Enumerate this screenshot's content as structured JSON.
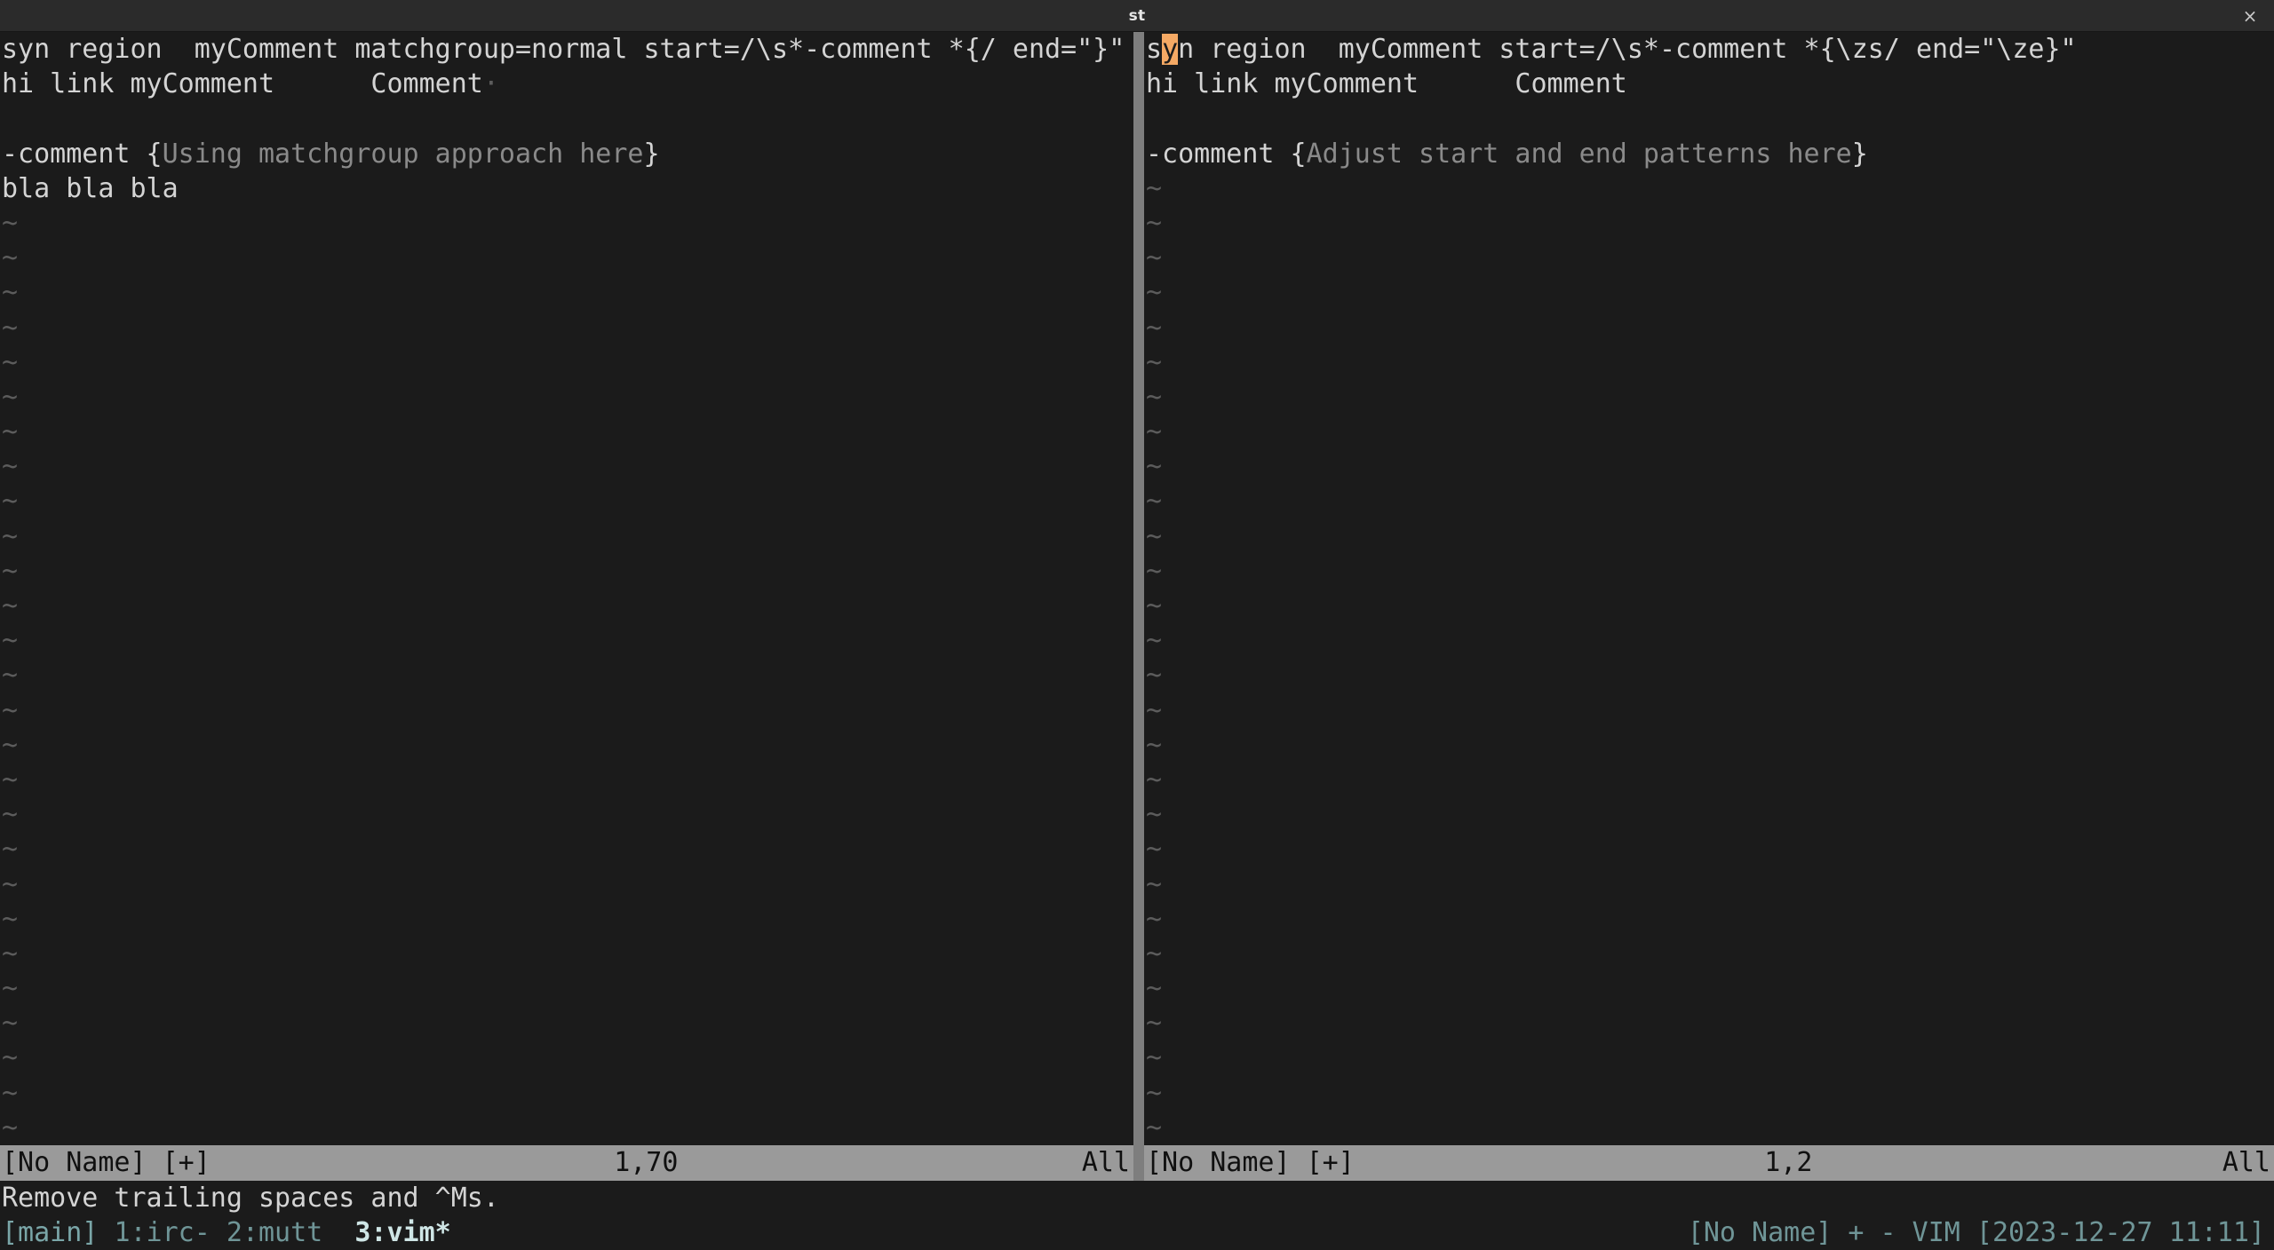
{
  "window": {
    "title": "st",
    "close_icon": "×"
  },
  "panes": [
    {
      "id": "left",
      "lines": [
        {
          "type": "code",
          "segments": [
            {
              "text": "syn region  myComment matchgroup=normal start=/\\s*-comment *{/ end=\"}\"",
              "style": "normal"
            }
          ]
        },
        {
          "type": "code",
          "segments": [
            {
              "text": "hi link myComment      Comment",
              "style": "normal"
            },
            {
              "text": "·",
              "style": "trailing-dot"
            }
          ]
        },
        {
          "type": "code",
          "segments": [
            {
              "text": "",
              "style": "normal"
            }
          ]
        },
        {
          "type": "code",
          "segments": [
            {
              "text": "-comment {",
              "style": "normal"
            },
            {
              "text": "Using matchgroup approach here",
              "style": "dim"
            },
            {
              "text": "}",
              "style": "normal"
            }
          ]
        },
        {
          "type": "code",
          "segments": [
            {
              "text": "bla bla bla",
              "style": "normal"
            }
          ]
        }
      ],
      "filler_char": "~",
      "filler_count": 27,
      "status": {
        "name": "[No Name] [+]",
        "position": "1,70",
        "scroll": "All"
      }
    },
    {
      "id": "right",
      "lines": [
        {
          "type": "code",
          "segments": [
            {
              "text": "s",
              "style": "normal"
            },
            {
              "text": "y",
              "style": "cursor"
            },
            {
              "text": "n region  myComment start=/\\s*-comment *{\\zs/ end=\"\\ze}\"",
              "style": "normal"
            }
          ]
        },
        {
          "type": "code",
          "segments": [
            {
              "text": "hi link myComment      Comment",
              "style": "normal"
            }
          ]
        },
        {
          "type": "code",
          "segments": [
            {
              "text": "",
              "style": "normal"
            }
          ]
        },
        {
          "type": "code",
          "segments": [
            {
              "text": "-comment {",
              "style": "normal"
            },
            {
              "text": "Adjust start and end patterns here",
              "style": "dim"
            },
            {
              "text": "}",
              "style": "normal"
            }
          ]
        }
      ],
      "filler_char": "~",
      "filler_count": 28,
      "status": {
        "name": "[No Name] [+]",
        "position": "1,2",
        "scroll": "All"
      }
    }
  ],
  "message_line": "Remove trailing spaces and ^Ms.",
  "tmux": {
    "session": "[main]",
    "windows": [
      {
        "label": "1:irc-",
        "active": false
      },
      {
        "label": "2:mutt",
        "active": false
      },
      {
        "label": "3:vim*",
        "active": true
      }
    ],
    "right": "[No Name] + - VIM [2023-12-27 11:11]"
  },
  "colors": {
    "background": "#1b1b1b",
    "foreground": "#d4d4d4",
    "dim_text": "#8a8a8a",
    "tilde": "#5c5c5c",
    "cursor": "#f5a964",
    "statusline_bg": "#9a9a9a",
    "statusline_fg": "#101010",
    "split_bar": "#7e7e7e",
    "titlebar_bg": "#2b2b2b",
    "tmux_teal": "#7aa6a8"
  }
}
